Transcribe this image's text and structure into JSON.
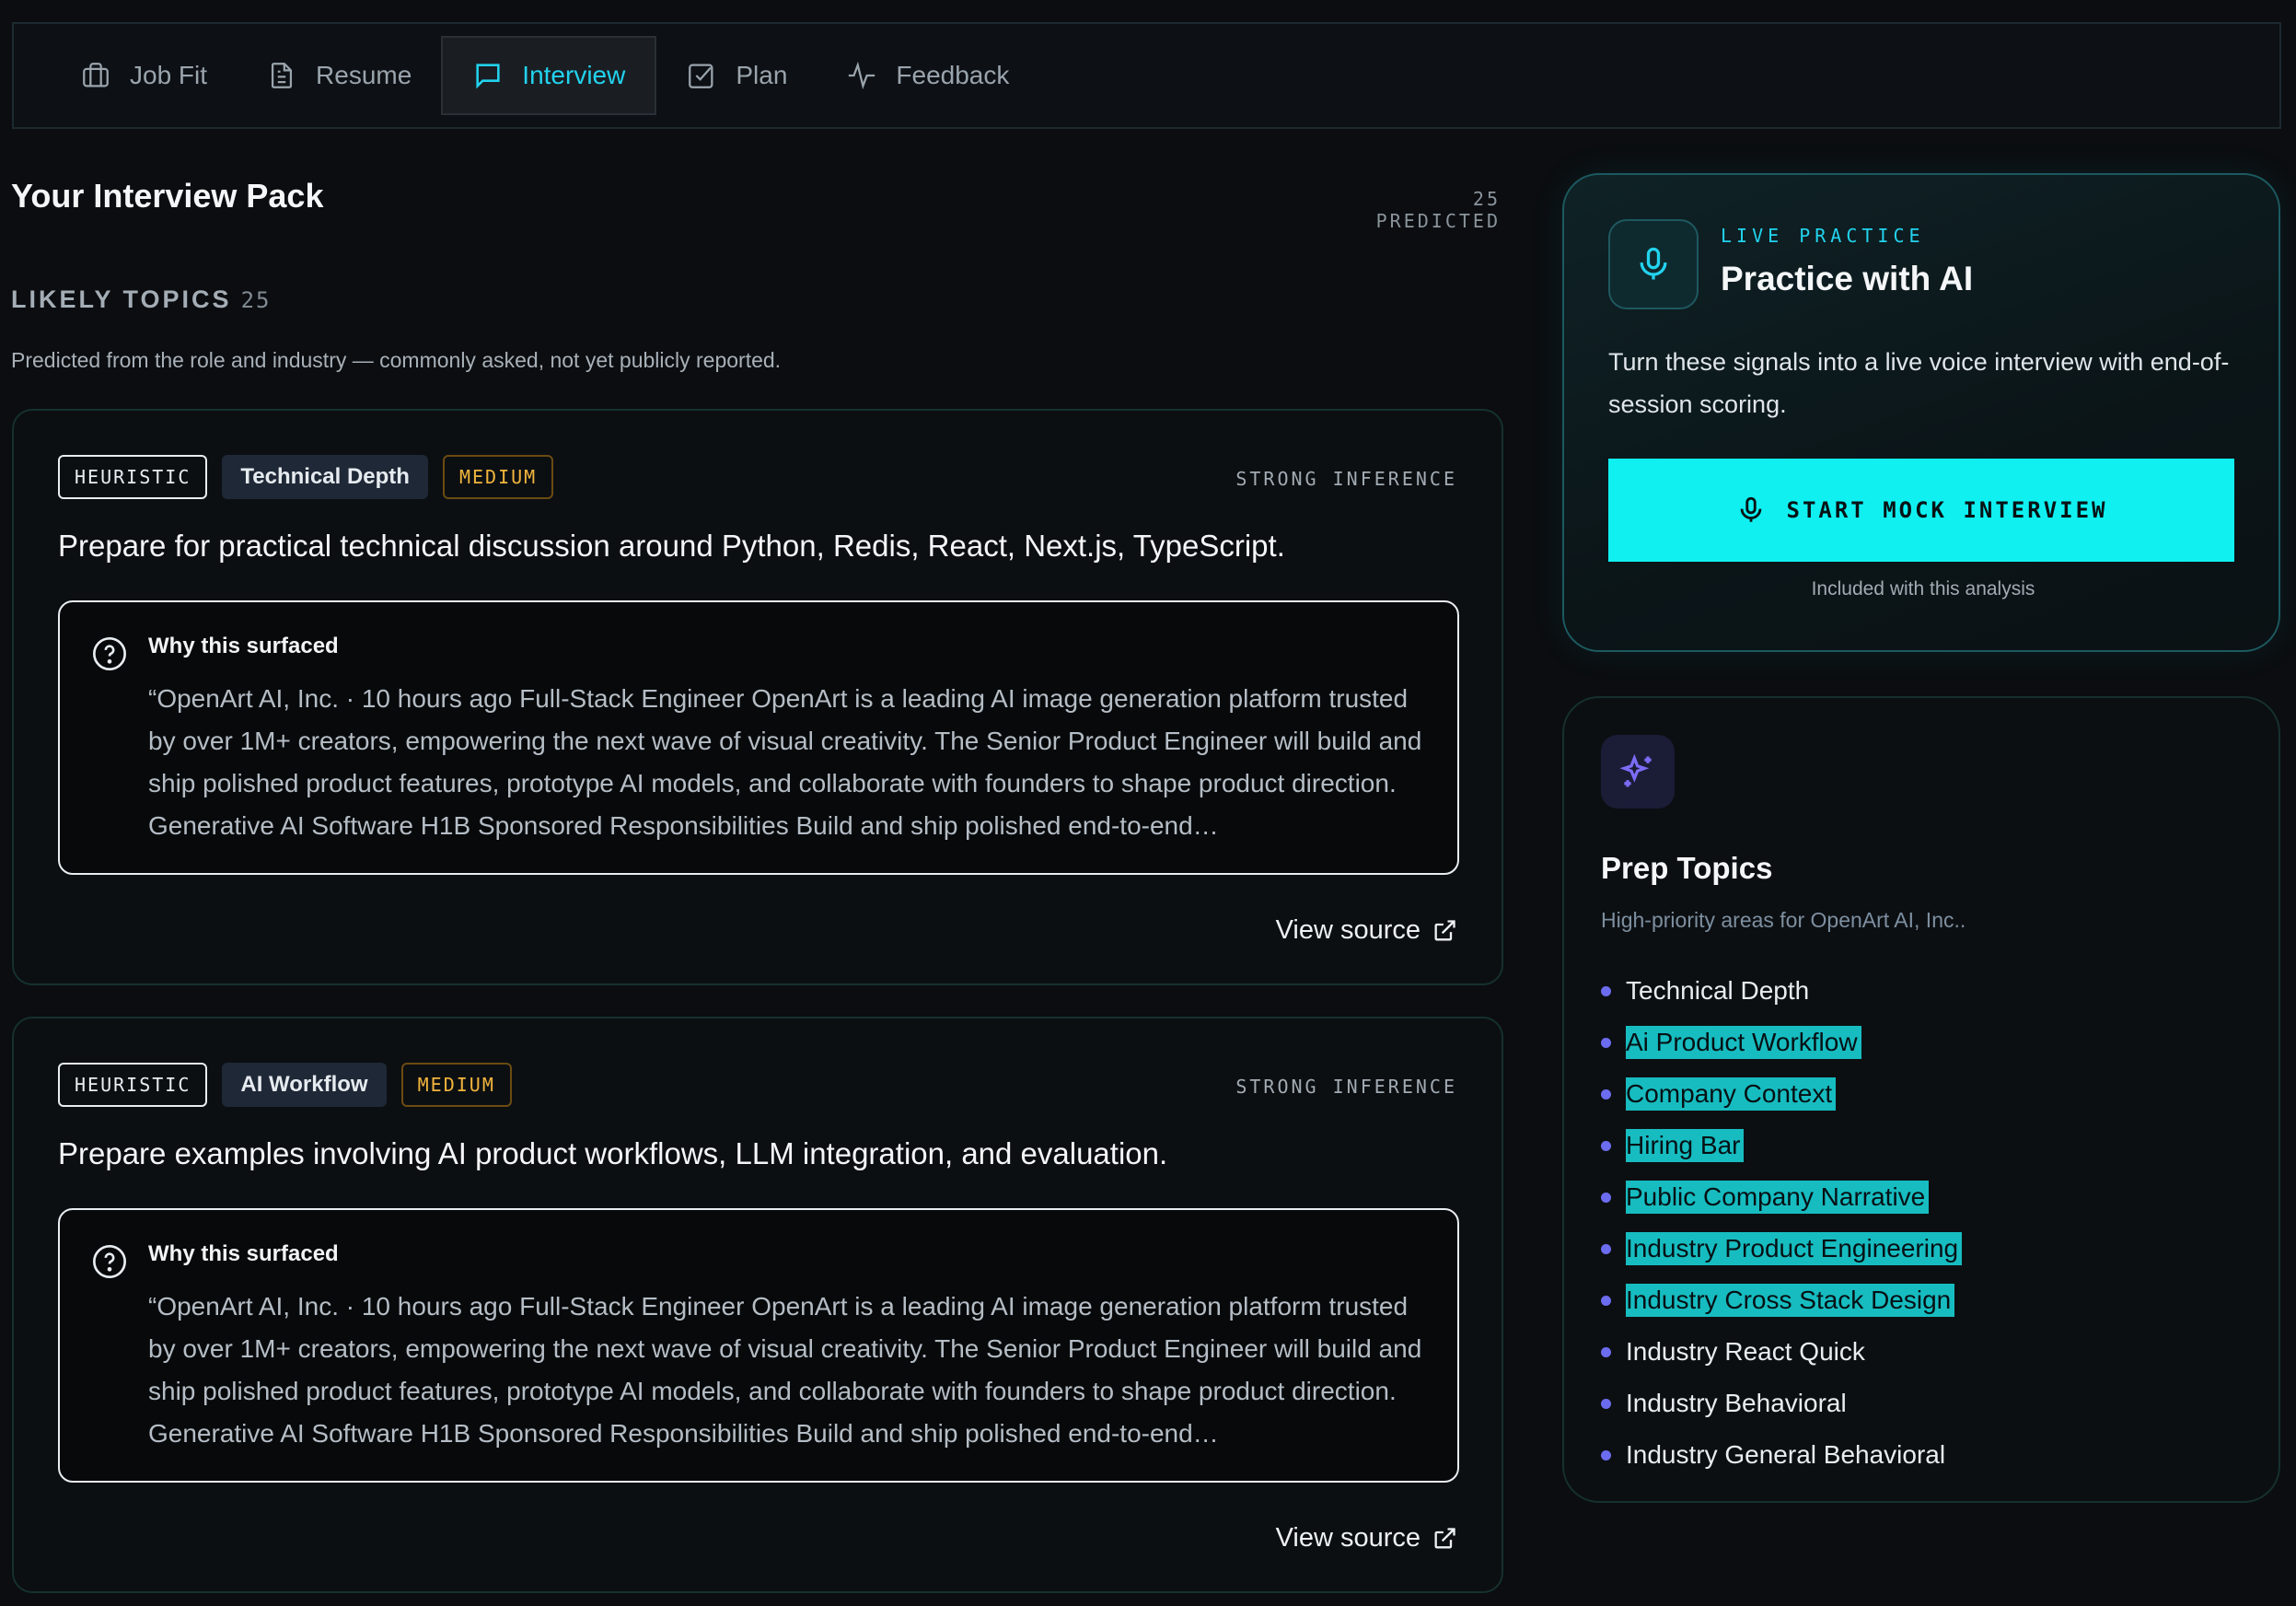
{
  "tabs": [
    {
      "label": "Job Fit",
      "icon": "briefcase-icon",
      "active": false
    },
    {
      "label": "Resume",
      "icon": "document-icon",
      "active": false
    },
    {
      "label": "Interview",
      "icon": "chat-icon",
      "active": true
    },
    {
      "label": "Plan",
      "icon": "checkbox-icon",
      "active": false
    },
    {
      "label": "Feedback",
      "icon": "pulse-icon",
      "active": false
    }
  ],
  "pack": {
    "title": "Your Interview Pack",
    "predicted": "25 PREDICTED"
  },
  "likely_topics": {
    "title": "LIKELY TOPICS",
    "count": "25",
    "description": "Predicted from the role and industry — commonly asked, not yet publicly reported."
  },
  "topics": [
    {
      "badge_source": "HEURISTIC",
      "category": "Technical Depth",
      "priority": "MEDIUM",
      "inference": "STRONG INFERENCE",
      "text": "Prepare for practical technical discussion around Python, Redis, React, Next.js, TypeScript.",
      "why_label": "Why this surfaced",
      "why_quote": "“OpenArt AI, Inc. · 10 hours ago Full-Stack Engineer OpenArt is a leading AI image generation platform trusted by over 1M+ creators, empowering the next wave of visual creativity. The Senior Product Engineer will build and ship polished product features, prototype AI models, and collaborate with founders to shape product direction. Generative AI Software H1B Sponsored Responsibilities Build and ship polished end-to-end…",
      "view_source": "View source"
    },
    {
      "badge_source": "HEURISTIC",
      "category": "AI Workflow",
      "priority": "MEDIUM",
      "inference": "STRONG INFERENCE",
      "text": "Prepare examples involving AI product workflows, LLM integration, and evaluation.",
      "why_label": "Why this surfaced",
      "why_quote": "“OpenArt AI, Inc. · 10 hours ago Full-Stack Engineer OpenArt is a leading AI image generation platform trusted by over 1M+ creators, empowering the next wave of visual creativity. The Senior Product Engineer will build and ship polished product features, prototype AI models, and collaborate with founders to shape product direction. Generative AI Software H1B Sponsored Responsibilities Build and ship polished end-to-end…",
      "view_source": "View source"
    }
  ],
  "practice": {
    "eyebrow": "LIVE PRACTICE",
    "title": "Practice with AI",
    "description": "Turn these signals into a live voice interview with end-of-session scoring.",
    "button": "START MOCK INTERVIEW",
    "note": "Included with this analysis"
  },
  "prep": {
    "title": "Prep Topics",
    "description": "High-priority areas for OpenArt AI, Inc..",
    "items": [
      {
        "label": "Technical Depth",
        "highlighted": false
      },
      {
        "label": "Ai Product Workflow",
        "highlighted": true
      },
      {
        "label": "Company Context",
        "highlighted": true
      },
      {
        "label": "Hiring Bar",
        "highlighted": true
      },
      {
        "label": "Public Company Narrative",
        "highlighted": true
      },
      {
        "label": "Industry Product Engineering",
        "highlighted": true
      },
      {
        "label": "Industry Cross Stack Design",
        "highlighted": true
      },
      {
        "label": "Industry React Quick",
        "highlighted": false
      },
      {
        "label": "Industry Behavioral",
        "highlighted": false
      },
      {
        "label": "Industry General Behavioral",
        "highlighted": false
      }
    ]
  },
  "colors": {
    "accent": "#22d3ee",
    "button": "#10f0f0",
    "highlight": "#17bcc0",
    "medium": "#f2b53c",
    "bullet": "#6c6cf0"
  }
}
